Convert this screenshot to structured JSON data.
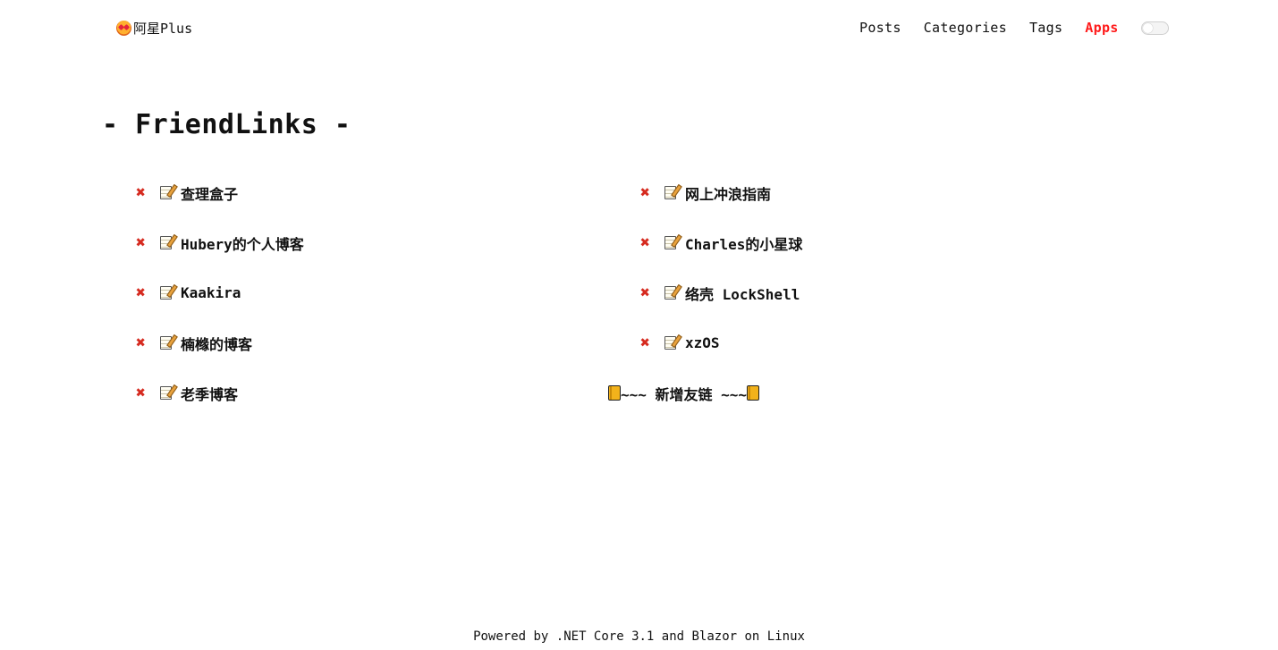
{
  "header": {
    "brand": "阿星Plus",
    "nav": [
      "Posts",
      "Categories",
      "Tags",
      "Apps"
    ],
    "active_nav": "Apps",
    "theme_toggle_on": false
  },
  "main": {
    "title": "- FriendLinks -",
    "links": [
      {
        "label": "查理盒子",
        "icon": "memo-icon"
      },
      {
        "label": "网上冲浪指南",
        "icon": "memo-icon"
      },
      {
        "label": "Hubery的个人博客",
        "icon": "memo-icon"
      },
      {
        "label": "Charles的小星球",
        "icon": "memo-icon"
      },
      {
        "label": "Kaakira",
        "icon": "memo-icon"
      },
      {
        "label": "络壳 LockShell",
        "icon": "memo-icon"
      },
      {
        "label": "楠橼的博客",
        "icon": "memo-icon"
      },
      {
        "label": "xzOS",
        "icon": "memo-icon"
      },
      {
        "label": "老季博客",
        "icon": "memo-icon"
      }
    ],
    "add_link_label": "~~~ 新增友链 ~~~"
  },
  "footer": {
    "text": "Powered by .NET Core 3.1 and Blazor on Linux"
  },
  "colors": {
    "accent": "#ff1a1a",
    "close_icon": "#d62b20"
  }
}
